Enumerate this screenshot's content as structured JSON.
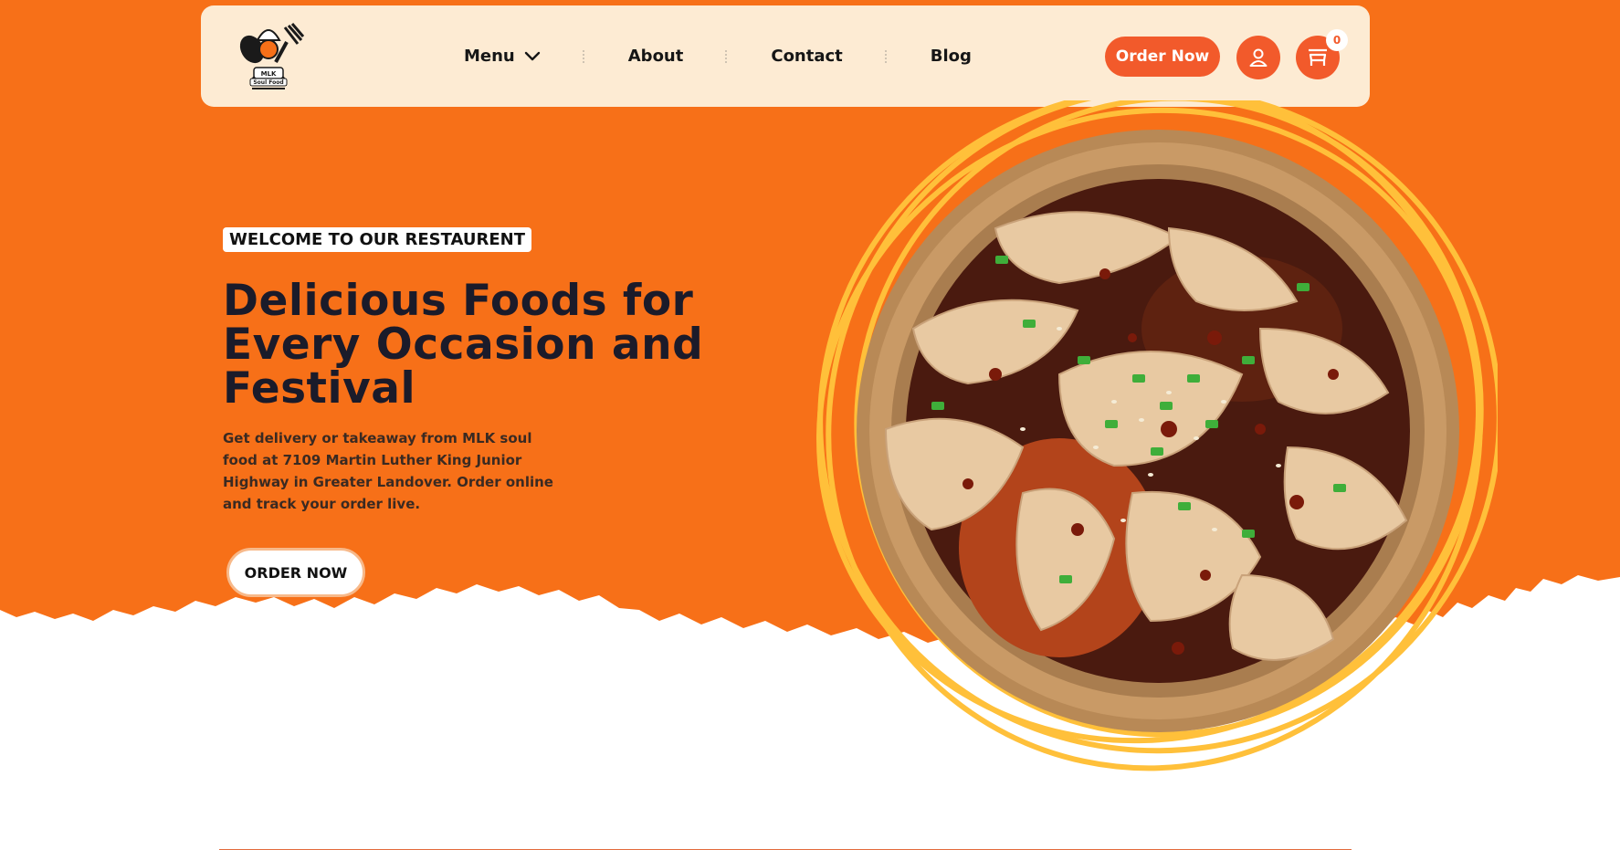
{
  "theme": {
    "hero_orange": "#f77018",
    "header_bg": "#fdebd3",
    "accent": "#f25a2b",
    "scribble": "#ffc03a"
  },
  "header": {
    "logo": {
      "icon": "chef-logo-icon",
      "text": "MLK Soul Food"
    },
    "nav": {
      "menu": "Menu",
      "about": "About",
      "contact": "Contact",
      "blog": "Blog"
    },
    "order_button": "Order Now",
    "user_icon": "user-icon",
    "cart_icon": "cart-icon",
    "cart_count": "0"
  },
  "hero": {
    "eyebrow": "WELCOME TO OUR RESTAURENT",
    "headline": "Delicious Foods for Every Occasion and Festival",
    "description": "Get delivery or takeaway from MLK soul food at 7109 Martin Luther King Junior Highway in Greater Landover. Order online and track your order live.",
    "cta": "ORDER NOW",
    "image": "chili-chicken-bowl"
  }
}
